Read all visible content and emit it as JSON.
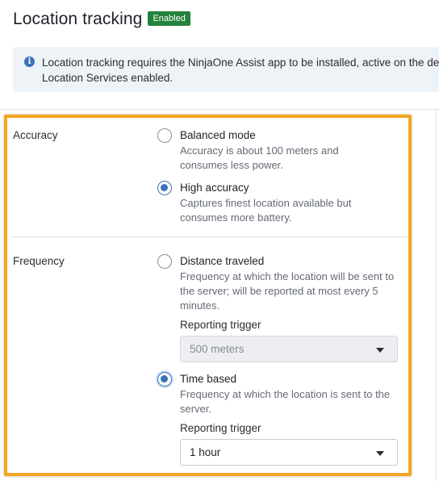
{
  "header": {
    "title": "Location tracking",
    "status_badge": "Enabled"
  },
  "info": {
    "icon": "info-circle-icon",
    "line1": "Location tracking requires the NinjaOne Assist app to be installed, active on the de",
    "line2": "Location Services enabled."
  },
  "accuracy": {
    "label": "Accuracy",
    "options": [
      {
        "title": "Balanced mode",
        "description": "Accuracy is about 100 meters and consumes less power.",
        "selected": false
      },
      {
        "title": "High accuracy",
        "description": "Captures finest location available but consumes more battery.",
        "selected": true
      }
    ]
  },
  "frequency": {
    "label": "Frequency",
    "options": [
      {
        "title": "Distance traveled",
        "description": "Frequency at which the location will be sent to the server; will be reported at most every 5 minutes.",
        "selected": false,
        "trigger_label": "Reporting trigger",
        "trigger_value": "500 meters",
        "trigger_disabled": true
      },
      {
        "title": "Time based",
        "description": "Frequency at which the location is sent to the server.",
        "selected": true,
        "trigger_label": "Reporting trigger",
        "trigger_value": "1 hour",
        "trigger_disabled": false
      }
    ]
  },
  "colors": {
    "badge_green": "#23823b",
    "info_background": "#eef3f8",
    "accent_blue": "#3b73b9",
    "highlight_border": "#f5a623"
  }
}
